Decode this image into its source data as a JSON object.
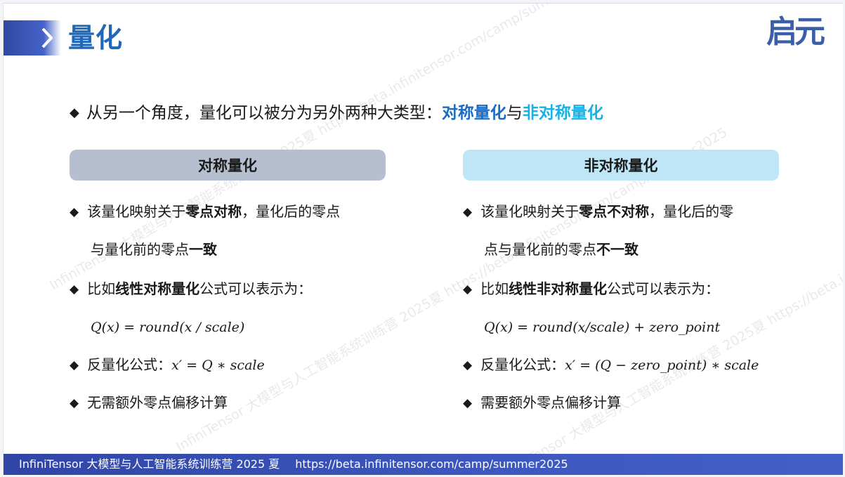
{
  "header": {
    "title": "量化",
    "logo_text": "启元"
  },
  "intro": {
    "text": "从另一个角度，量化可以被分为另外两种大类型：",
    "symmetric": "对称量化",
    "connector": "与",
    "asymmetric": "非对称量化"
  },
  "left": {
    "heading": "对称量化",
    "items": [
      {
        "pre": "该量化映射关于",
        "bold": "零点对称",
        "post": "，量化后的零点"
      },
      {
        "pre": "与量化前的零点",
        "bold": "一致",
        "post": ""
      },
      {
        "pre": "比如",
        "bold": "线性对称量化",
        "post": "公式可以表示为："
      },
      {
        "formula": "Q(x)  =  round(x / scale)"
      },
      {
        "pre": "反量化公式：",
        "formula": "x′ = Q ∗ scale"
      },
      {
        "pre": "无需额外零点偏移计算"
      }
    ]
  },
  "right": {
    "heading": "非对称量化",
    "items": [
      {
        "pre": "该量化映射关于",
        "bold": "零点不对称",
        "post": "，量化后的零"
      },
      {
        "pre": "点与量化前的零点",
        "bold": "不一致",
        "post": ""
      },
      {
        "pre": "比如",
        "bold": "线性非对称量化",
        "post": "公式可以表示为："
      },
      {
        "formula": "Q(x) =  round(x/scale) + zero_point"
      },
      {
        "pre": "反量化公式：",
        "formula": "x′ = (Q − zero_point) ∗ scale"
      },
      {
        "pre": "需要额外零点偏移计算"
      }
    ]
  },
  "footer": {
    "text": "InfiniTensor 大模型与人工智能系统训练营 2025 夏",
    "url": "https://beta.infinitensor.com/camp/summer2025"
  },
  "watermark": {
    "text": "InfiniTensor 大模型与人工智能系统训练营 2025夏 https://beta.infinitensor.com/camp/summer2025"
  },
  "colors": {
    "title": "#1f67b8",
    "highlight_dark": "#1a6bc4",
    "highlight_cyan": "#18b1e3",
    "left_header_bg": "#b6bfcf",
    "right_header_bg": "#bfe6f7",
    "footer_bg": "#3d58bf"
  },
  "icons": {
    "bullet": "diamond-bullet-icon",
    "title_marker": "chevron-right-icon"
  }
}
